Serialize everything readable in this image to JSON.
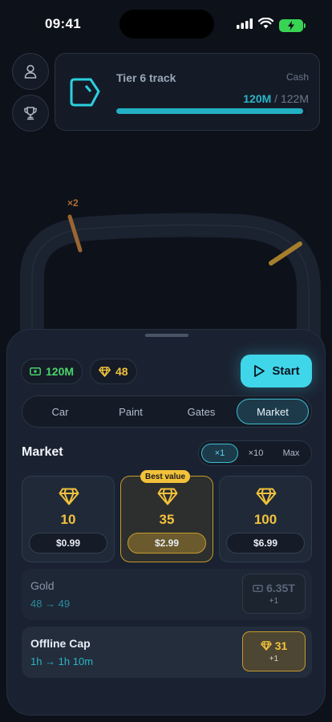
{
  "status": {
    "time": "09:41"
  },
  "track": {
    "title": "Tier 6 track",
    "cash_label": "Cash",
    "cash_current": "120M",
    "cash_separator": " / ",
    "cash_max": "122M",
    "cash_progress": 0.984
  },
  "race": {
    "multiplier_label": "×2"
  },
  "wallet": {
    "cash": "120M",
    "gems": "48"
  },
  "start_label": "Start",
  "tabs": [
    {
      "label": "Car",
      "active": false
    },
    {
      "label": "Paint",
      "active": false
    },
    {
      "label": "Gates",
      "active": false
    },
    {
      "label": "Market",
      "active": true
    }
  ],
  "market": {
    "title": "Market",
    "multipliers": [
      {
        "label": "×1",
        "active": true
      },
      {
        "label": "×10",
        "active": false
      },
      {
        "label": "Max",
        "active": false
      }
    ],
    "packs": [
      {
        "amount": "10",
        "price": "$0.99",
        "badge": ""
      },
      {
        "amount": "35",
        "price": "$2.99",
        "badge": "Best value"
      },
      {
        "amount": "100",
        "price": "$6.99",
        "badge": ""
      }
    ]
  },
  "upgrades": [
    {
      "name": "Gold",
      "change": "48 → 49",
      "cost": "6.35T",
      "plus": "+1",
      "currency": "cash",
      "enabled": false
    },
    {
      "name": "Offline Cap",
      "change": "1h → 1h 10m",
      "cost": "31",
      "plus": "+1",
      "currency": "gem",
      "enabled": true
    }
  ],
  "colors": {
    "accent": "#3fd6ea",
    "gold": "#f2c23b",
    "cash_green": "#4bd36a",
    "panel": "#1a2231"
  }
}
